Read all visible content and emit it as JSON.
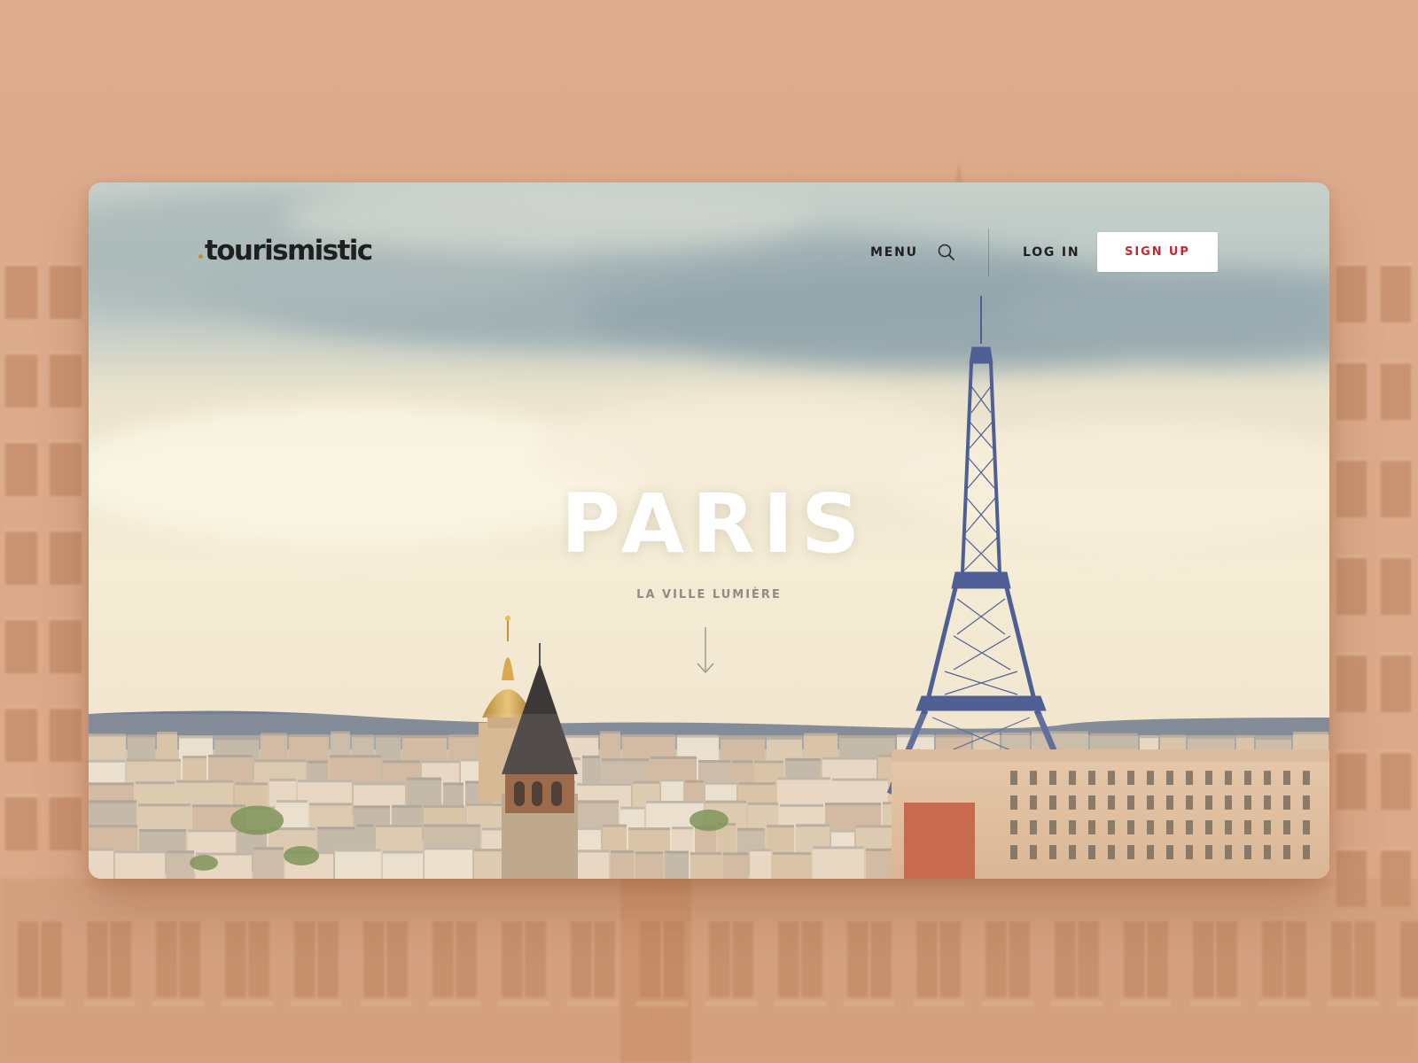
{
  "site": {
    "logo_text": "tourismistic"
  },
  "nav": {
    "menu_label": "MENU",
    "search_icon": "search-icon",
    "login_label": "LOG IN",
    "signup_label": "SIGN UP"
  },
  "hero": {
    "title": "PARIS",
    "subtitle": "LA VILLE LUMIÈRE",
    "scroll_icon": "arrow-down-icon"
  },
  "colors": {
    "backdrop": "#dcaa88",
    "logo_dot": "#c58a3c",
    "signup_text": "#c4282f",
    "text_dark": "#1f1f1f",
    "subtitle": "#8f8c87"
  }
}
